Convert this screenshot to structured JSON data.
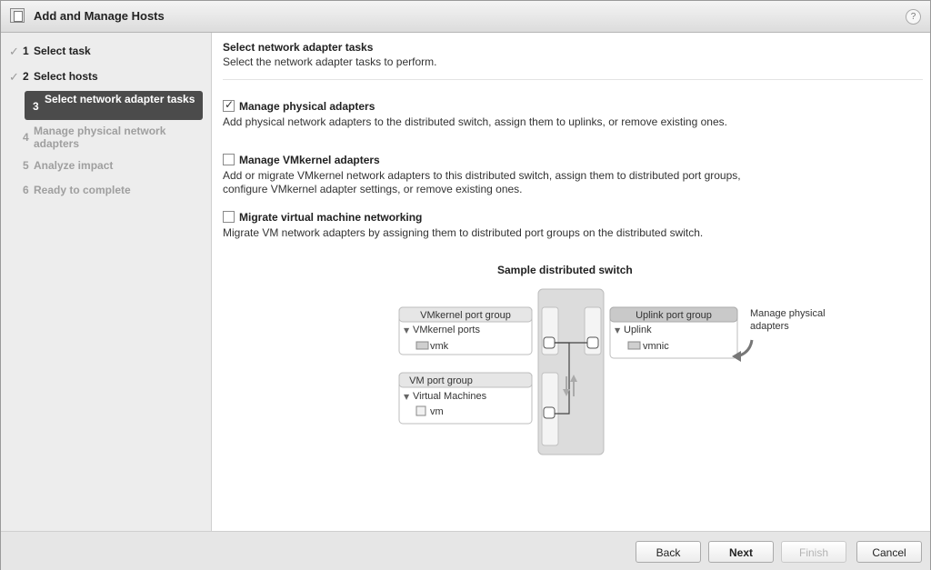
{
  "window": {
    "title": "Add and Manage Hosts",
    "help": "?"
  },
  "nav": {
    "steps": [
      {
        "number": "1",
        "label": "Select task",
        "state": "done"
      },
      {
        "number": "2",
        "label": "Select hosts",
        "state": "done"
      },
      {
        "number": "3",
        "label": "Select network adapter tasks",
        "state": "active"
      },
      {
        "number": "4",
        "label": "Manage physical network adapters",
        "state": "disabled"
      },
      {
        "number": "5",
        "label": "Analyze impact",
        "state": "disabled"
      },
      {
        "number": "6",
        "label": "Ready to complete",
        "state": "disabled"
      }
    ]
  },
  "main": {
    "heading": "Select network adapter tasks",
    "subheading": "Select the network adapter tasks to perform.",
    "options": [
      {
        "label": "Manage physical adapters",
        "checked": true,
        "description": "Add physical network adapters to the distributed switch, assign them to uplinks, or remove existing ones."
      },
      {
        "label": "Manage VMkernel adapters",
        "checked": false,
        "description": "Add or migrate VMkernel network adapters to this distributed switch, assign them to distributed port groups, configure VMkernel adapter settings, or remove existing ones."
      },
      {
        "label": "Migrate virtual machine networking",
        "checked": false,
        "description": "Migrate VM network adapters by assigning them to distributed port groups on the distributed switch."
      }
    ]
  },
  "diagram": {
    "title": "Sample distributed switch",
    "vmkernel_group": {
      "title": "VMkernel port group",
      "subtitle": "VMkernel ports",
      "item": "vmk"
    },
    "vm_group": {
      "title": "VM port group",
      "subtitle": "Virtual Machines",
      "item": "vm"
    },
    "uplink_group": {
      "title": "Uplink port group",
      "subtitle": "Uplink",
      "item": "vmnic"
    },
    "callout_line1": "Manage physical",
    "callout_line2": "adapters"
  },
  "footer": {
    "back": "Back",
    "next": "Next",
    "finish": "Finish",
    "cancel": "Cancel"
  }
}
